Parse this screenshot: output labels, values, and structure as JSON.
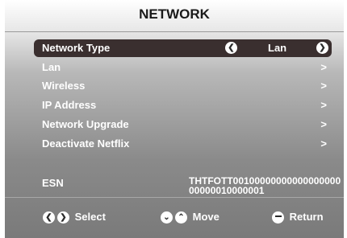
{
  "title": "NETWORK",
  "menu": [
    {
      "label": "Network Type",
      "value": "Lan",
      "selected": true
    },
    {
      "label": "Lan",
      "chevron": ">"
    },
    {
      "label": "Wireless",
      "chevron": ">"
    },
    {
      "label": "IP Address",
      "chevron": ">"
    },
    {
      "label": "Network Upgrade",
      "chevron": ">"
    },
    {
      "label": "Deactivate Netflix",
      "chevron": ">"
    }
  ],
  "esn": {
    "label": "ESN",
    "value": "THTFOTT0010000000000000000000000010000001"
  },
  "footer": {
    "select_label": "Select",
    "move_label": "Move",
    "return_label": "Return"
  },
  "icons": {
    "left": "chevron-left-icon",
    "right": "chevron-right-icon",
    "down": "chevron-down-icon",
    "up": "chevron-up-icon",
    "return": "return-icon"
  }
}
